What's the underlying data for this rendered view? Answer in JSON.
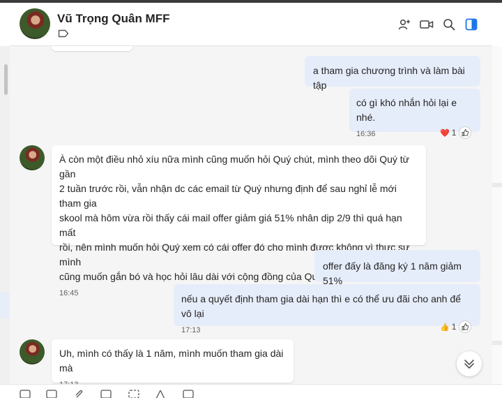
{
  "header": {
    "contact_name": "Vũ Trọng Quân MFF",
    "icons": [
      "label-icon",
      "add-people-icon",
      "video-call-icon",
      "search-icon",
      "side-panel-icon"
    ]
  },
  "messages": [
    {
      "id": "m1",
      "direction": "outgoing",
      "text": "a tham gia chương trình và làm bài tập",
      "time": ""
    },
    {
      "id": "m2",
      "direction": "outgoing",
      "text": "có gì khó nhắn hỏi lại e nhé.",
      "time": "16:36",
      "reaction": {
        "emoji": "❤️",
        "count": "1"
      }
    },
    {
      "id": "m3",
      "direction": "incoming",
      "lines": [
        "À còn một điều nhỏ xíu nữa mình cũng muốn hỏi Quý chút, mình theo dõi Quý từ gần",
        "2 tuần trước rồi, vẫn nhận dc các email từ Quý nhưng định để sau nghỉ lễ mới tham gia",
        "skool mà hôm vừa rồi thấy cái mail offer giảm giá 51% nhân dịp 2/9 thì quá hạn mất",
        "rồi, nên mình muốn hỏi Quý xem có cái offer đó cho mình được không vì thực sự mình",
        "cũng muốn gắn bó và học hỏi lâu dài với cộng đồng của Quý ấy 😁"
      ],
      "time": "16:45"
    },
    {
      "id": "m4",
      "direction": "outgoing",
      "text": "offer đấy là đăng ký 1 năm giảm 51%",
      "time": ""
    },
    {
      "id": "m5",
      "direction": "outgoing",
      "text": "nếu a quyết định tham gia dài hạn thì e có thể ưu đãi cho anh để vô lại",
      "time": "17:13",
      "reaction": {
        "emoji": "👍",
        "count": "1"
      }
    },
    {
      "id": "m6",
      "direction": "incoming",
      "text": "Uh, mình có thấy là 1 năm, mình muốn tham gia dài mà",
      "time": "17:13"
    }
  ],
  "colors": {
    "outgoing_bubble": "#e6edfa",
    "incoming_bubble": "#ffffff",
    "chat_bg": "#f5f5f5",
    "accent": "#1a73e8"
  }
}
